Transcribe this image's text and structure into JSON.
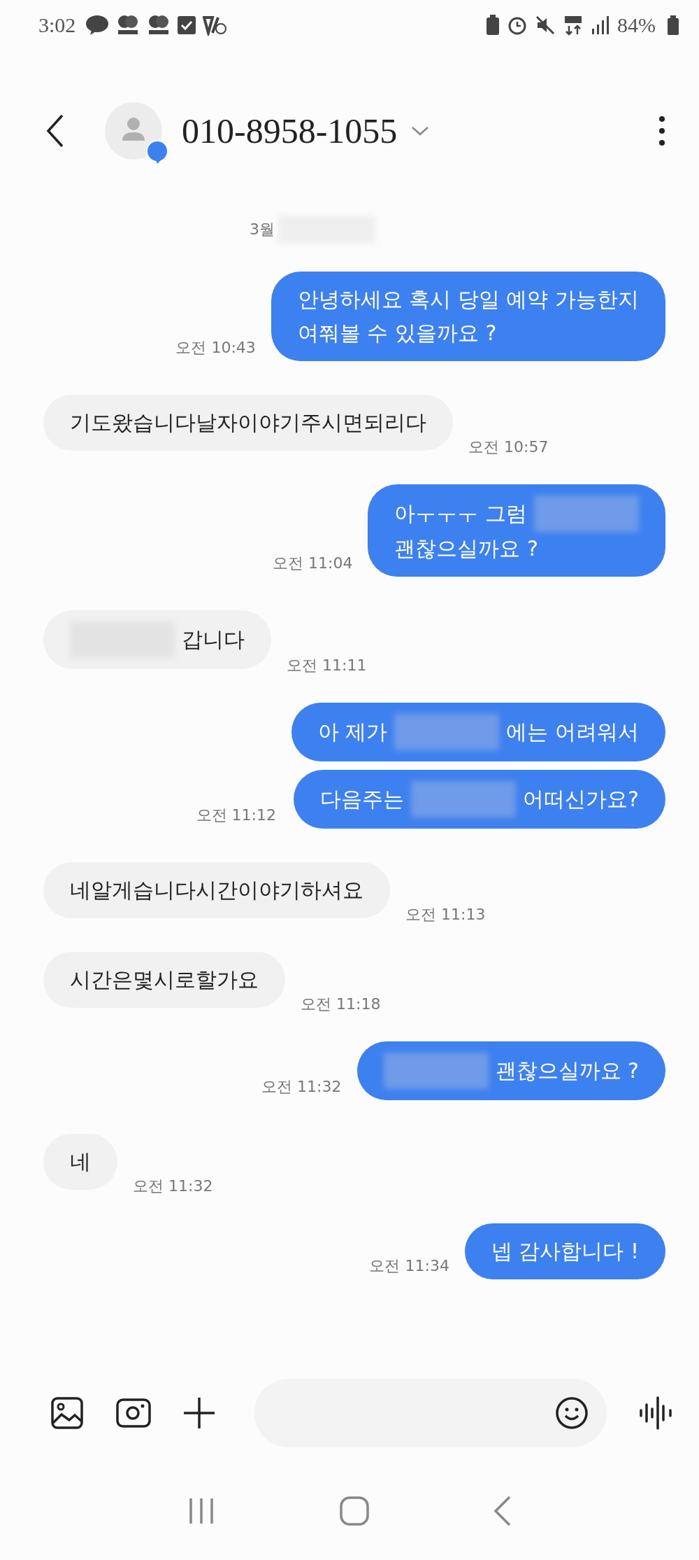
{
  "status_bar": {
    "time": "3:02",
    "battery": "84%"
  },
  "header": {
    "contact": "010-8958-1055"
  },
  "date_divider": [
    {
      "kind": "text",
      "text": "3월"
    },
    {
      "kind": "redacted"
    }
  ],
  "messages": [
    {
      "kind": "sent",
      "time": "오전 10:43",
      "bubbles": [
        [
          [
            {
              "kind": "text",
              "text": "안녕하세요 혹시 당일 예약 가능한지"
            }
          ],
          [
            {
              "kind": "text",
              "text": "여쭤볼 수 있을까요 ?"
            }
          ]
        ]
      ]
    },
    {
      "kind": "received",
      "time": "오전 10:57",
      "bubbles": [
        [
          [
            {
              "kind": "text",
              "text": "기도왔습니다날자이야기주시면되리다"
            }
          ]
        ]
      ]
    },
    {
      "kind": "sent",
      "time": "오전 11:04",
      "bubbles": [
        [
          [
            {
              "kind": "text",
              "text": "아ㅜㅜㅜ 그럼"
            },
            {
              "kind": "redacted"
            }
          ],
          [
            {
              "kind": "text",
              "text": "괜찮으실까요 ?"
            }
          ]
        ]
      ]
    },
    {
      "kind": "received",
      "time": "오전 11:11",
      "bubbles": [
        [
          [
            {
              "kind": "redacted"
            },
            {
              "kind": "text",
              "text": "갑니다"
            }
          ]
        ]
      ]
    },
    {
      "kind": "sent",
      "time": "오전 11:12",
      "bubbles": [
        [
          [
            {
              "kind": "text",
              "text": "아 제가"
            },
            {
              "kind": "redacted"
            },
            {
              "kind": "text",
              "text": "에는 어려워서"
            }
          ]
        ],
        [
          [
            {
              "kind": "text",
              "text": "다음주는"
            },
            {
              "kind": "redacted"
            },
            {
              "kind": "text",
              "text": "어떠신가요?"
            }
          ]
        ]
      ]
    },
    {
      "kind": "received",
      "time": "오전 11:13",
      "bubbles": [
        [
          [
            {
              "kind": "text",
              "text": "네알게습니다시간이야기하셔요"
            }
          ]
        ]
      ]
    },
    {
      "kind": "received",
      "time": "오전 11:18",
      "bubbles": [
        [
          [
            {
              "kind": "text",
              "text": "시간은몇시로할가요"
            }
          ]
        ]
      ]
    },
    {
      "kind": "sent",
      "time": "오전 11:32",
      "bubbles": [
        [
          [
            {
              "kind": "redacted"
            },
            {
              "kind": "text",
              "text": "괜찮으실까요 ?"
            }
          ]
        ]
      ]
    },
    {
      "kind": "received",
      "time": "오전 11:32",
      "bubbles": [
        [
          [
            {
              "kind": "text",
              "text": "네"
            }
          ]
        ]
      ]
    },
    {
      "kind": "sent",
      "time": "오전 11:34",
      "bubbles": [
        [
          [
            {
              "kind": "text",
              "text": "넵 감사합니다 !"
            }
          ]
        ]
      ]
    }
  ]
}
